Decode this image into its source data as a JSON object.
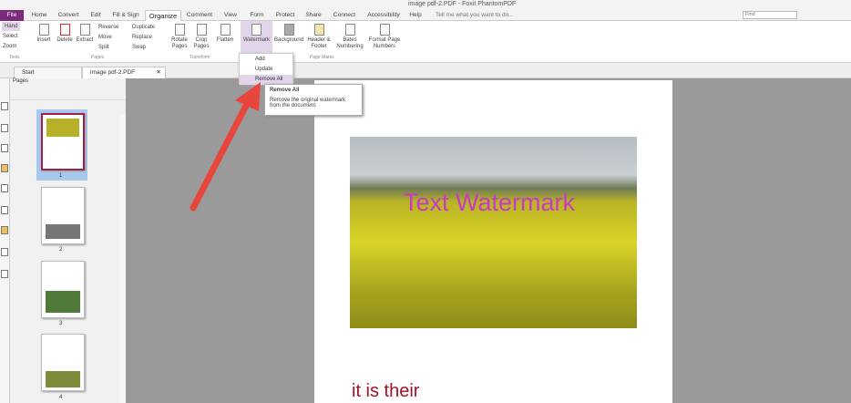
{
  "window": {
    "title": "image pdf-2.PDF - Foxit PhantomPDF"
  },
  "menu_tabs": [
    "File",
    "Home",
    "Convert",
    "Edit",
    "Fill & Sign",
    "Organize",
    "Comment",
    "View",
    "Form",
    "Protect",
    "Share",
    "Connect",
    "Accessibility",
    "Help"
  ],
  "active_tab": "Organize",
  "tell_me": "Tell me what you want to do...",
  "find_placeholder": "Find",
  "ribbon": {
    "tools": {
      "hand": "Hand",
      "select": "Select",
      "zoom": "Zoom",
      "group": "Tools"
    },
    "pages": {
      "insert": "Insert",
      "delete": "Delete",
      "extract": "Extract",
      "reverse": "Reverse",
      "move": "Move",
      "split": "Split",
      "duplicate": "Duplicate",
      "replace": "Replace",
      "swap": "Swap",
      "group": "Pages"
    },
    "transform": {
      "rotate": "Rotate Pages",
      "crop": "Crop Pages",
      "flatten": "Flatten",
      "group": "Transform"
    },
    "page_marks": {
      "watermark": "Watermark",
      "background": "Background",
      "header_footer": "Header & Footer",
      "bates": "Bates Numbering",
      "format_page_numbers": "Format Page Numbers",
      "group": "Page Marks"
    }
  },
  "watermark_menu": {
    "items": [
      "Add",
      "Update",
      "Remove All"
    ],
    "highlighted": "Remove All"
  },
  "tooltip": {
    "title": "Remove All",
    "text": "Remove the original watermark from the document."
  },
  "doc_tabs": [
    "Start",
    "image pdf-2.PDF"
  ],
  "pages_panel": {
    "title": "Pages",
    "thumbnails": [
      "1",
      "2",
      "3",
      "4"
    ],
    "selected": "1"
  },
  "document": {
    "watermark_text": "Text Watermark",
    "body_text": "it is their"
  },
  "colors": {
    "accent": "#7b2a7b",
    "watermark": "#c83ac7",
    "arrow": "#e8453c",
    "body_text": "#a3122a"
  }
}
